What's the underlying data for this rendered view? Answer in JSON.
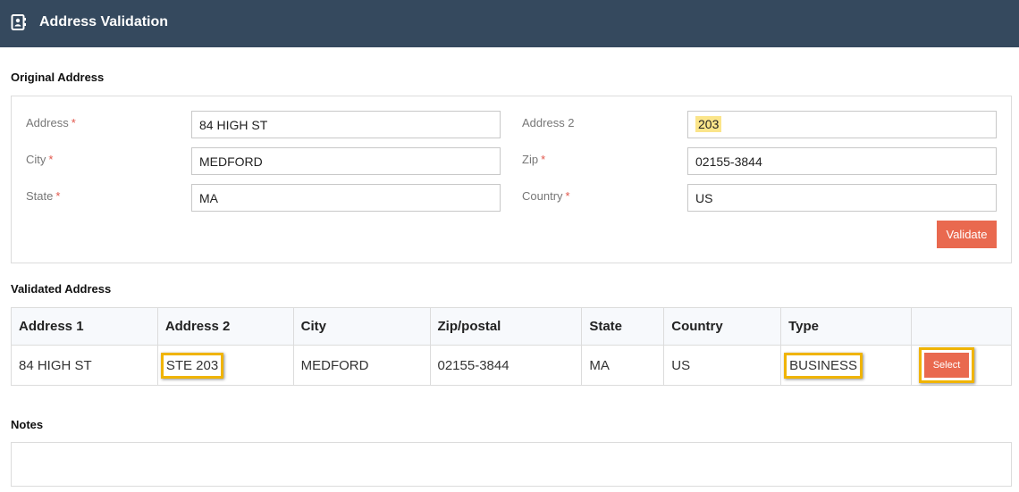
{
  "header": {
    "title": "Address Validation",
    "icon": "address-book-icon",
    "bg_color": "#35495e"
  },
  "original": {
    "section_title": "Original Address",
    "required_marker": "*",
    "fields": {
      "address": {
        "label": "Address",
        "value": "84 HIGH ST"
      },
      "address2": {
        "label": "Address 2",
        "value": "203"
      },
      "city": {
        "label": "City",
        "value": "MEDFORD"
      },
      "zip": {
        "label": "Zip",
        "value": "02155-3844"
      },
      "state": {
        "label": "State",
        "value": "MA"
      },
      "country": {
        "label": "Country",
        "value": "US"
      }
    },
    "validate_label": "Validate"
  },
  "validated": {
    "section_title": "Validated Address",
    "columns": [
      "Address 1",
      "Address 2",
      "City",
      "Zip/postal",
      "State",
      "Country",
      "Type",
      ""
    ],
    "rows": [
      {
        "address1": "84 HIGH ST",
        "address2": "STE 203",
        "city": "MEDFORD",
        "zip": "02155-3844",
        "state": "MA",
        "country": "US",
        "type": "BUSINESS",
        "action": "Select"
      }
    ]
  },
  "notes": {
    "section_title": "Notes",
    "value": ""
  },
  "colors": {
    "accent": "#e9694f",
    "highlight_outline": "#f0b400",
    "required": "#e2574c",
    "text_highlight": "#fbe58a"
  }
}
